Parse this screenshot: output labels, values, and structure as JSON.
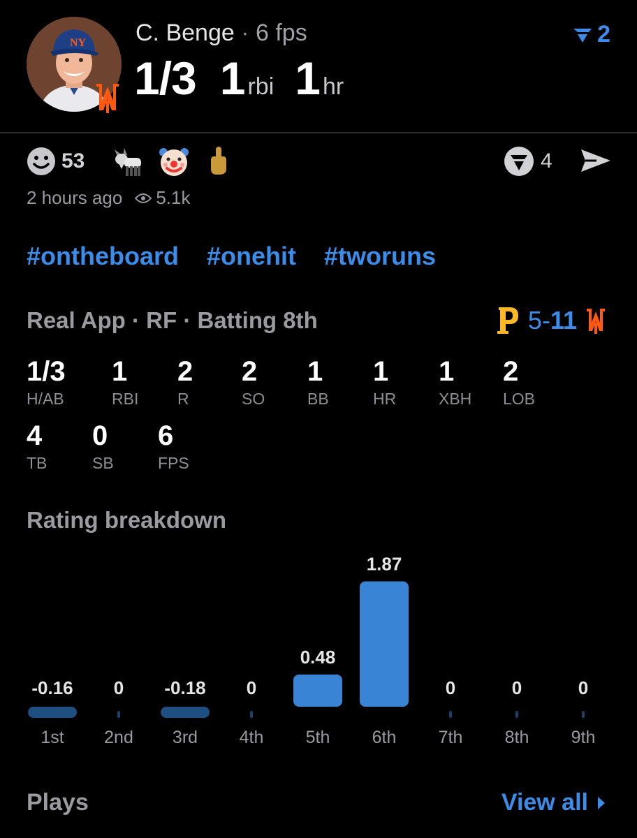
{
  "player": {
    "name": "C. Benge",
    "separator": "·",
    "fps": "6 fps",
    "stats": [
      {
        "value": "1/3",
        "unit": ""
      },
      {
        "value": "1",
        "unit": "rbi"
      },
      {
        "value": "1",
        "unit": "hr"
      }
    ],
    "rank": "2"
  },
  "reactions": {
    "smile_count": "53",
    "comments_count": "4",
    "posted": "2 hours ago",
    "views": "5.1k"
  },
  "tags": [
    "#ontheboard",
    "#onehit",
    "#tworuns"
  ],
  "game": {
    "source": "Real App",
    "position": "RF",
    "batting": "Batting 8th",
    "separator": "·",
    "score_left": "5",
    "score_dash": "-",
    "score_right": "11"
  },
  "box": [
    {
      "value": "1/3",
      "label": "H/AB"
    },
    {
      "value": "1",
      "label": "RBI"
    },
    {
      "value": "2",
      "label": "R"
    },
    {
      "value": "2",
      "label": "SO"
    },
    {
      "value": "1",
      "label": "BB"
    },
    {
      "value": "1",
      "label": "HR"
    },
    {
      "value": "1",
      "label": "XBH"
    },
    {
      "value": "2",
      "label": "LOB"
    },
    {
      "value": "4",
      "label": "TB"
    },
    {
      "value": "0",
      "label": "SB"
    },
    {
      "value": "6",
      "label": "FPS"
    }
  ],
  "rating_title": "Rating breakdown",
  "chart_data": {
    "type": "bar",
    "categories": [
      "1st",
      "2nd",
      "3rd",
      "4th",
      "5th",
      "6th",
      "7th",
      "8th",
      "9th"
    ],
    "values": [
      -0.16,
      0,
      -0.18,
      0,
      0.48,
      1.87,
      0,
      0,
      0
    ],
    "labels": [
      "-0.16",
      "0",
      "-0.18",
      "0",
      "0.48",
      "1.87",
      "0",
      "0",
      "0"
    ],
    "title": "Rating breakdown",
    "colors": {
      "positive": "#3a84d6",
      "negative": "#1e4f80",
      "zero": "#1e3f66"
    }
  },
  "plays": {
    "title": "Plays",
    "view_all": "View all"
  },
  "colors": {
    "accent": "#3a8de8",
    "background": "#000000",
    "muted": "#9a9aa0",
    "mets_orange": "#ff5910",
    "pirates_gold": "#fdb827"
  }
}
